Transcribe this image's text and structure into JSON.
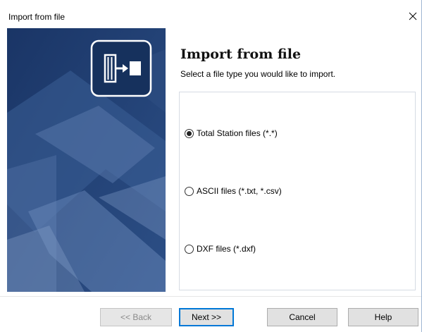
{
  "window": {
    "title": "Import from file"
  },
  "header": {
    "title": "Import from file",
    "subtitle": "Select a file type you would like to import."
  },
  "options": [
    {
      "label": "Total Station files (*.*)",
      "checked": true
    },
    {
      "label": "ASCII files (*.txt, *.csv)",
      "checked": false
    },
    {
      "label": "DXF files (*.dxf)",
      "checked": false
    }
  ],
  "buttons": {
    "back": "<< Back",
    "next": "Next >>",
    "cancel": "Cancel",
    "help": "Help"
  },
  "colors": {
    "panel_dark": "#1e3c6e",
    "panel_light": "#6f8fbf",
    "accent": "#0078d7"
  },
  "icons": {
    "close": "close-icon",
    "import": "import-file-icon"
  }
}
